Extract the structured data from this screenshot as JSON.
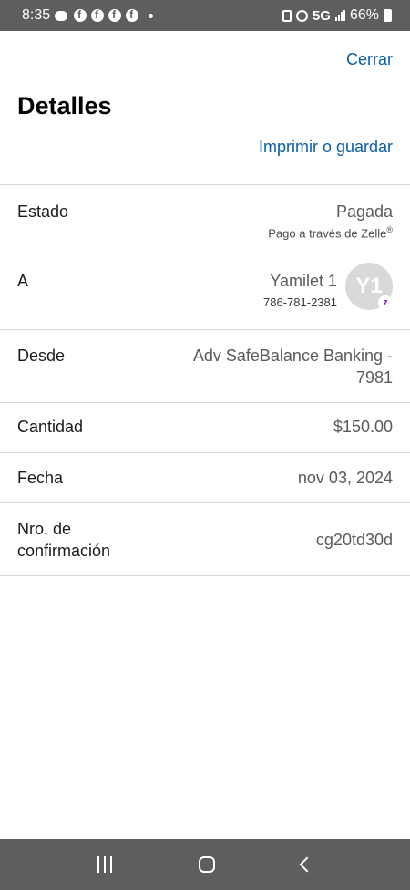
{
  "status_bar": {
    "time": "8:35",
    "network": "5G",
    "battery": "66%"
  },
  "header": {
    "close_label": "Cerrar",
    "title": "Detalles",
    "print_label": "Imprimir o guardar"
  },
  "details": {
    "estado": {
      "label": "Estado",
      "value": "Pagada",
      "sub": "Pago a través de Zelle",
      "sub_mark": "®"
    },
    "recipient": {
      "label": "A",
      "name": "Yamilet 1",
      "phone": "786-781-2381",
      "avatar_initials": "Y1",
      "badge": "z"
    },
    "desde": {
      "label": "Desde",
      "value_line1": "Adv SafeBalance Banking -",
      "value_line2": "7981"
    },
    "cantidad": {
      "label": "Cantidad",
      "value": "$150.00"
    },
    "fecha": {
      "label": "Fecha",
      "value": "nov 03, 2024"
    },
    "confirmacion": {
      "label_line1": "Nro. de",
      "label_line2": "confirmación",
      "value": "cg20td30d"
    }
  },
  "colors": {
    "link": "#0a5fa6",
    "system_bar": "#5e5e5e",
    "zelle_purple": "#6d1ed4"
  }
}
